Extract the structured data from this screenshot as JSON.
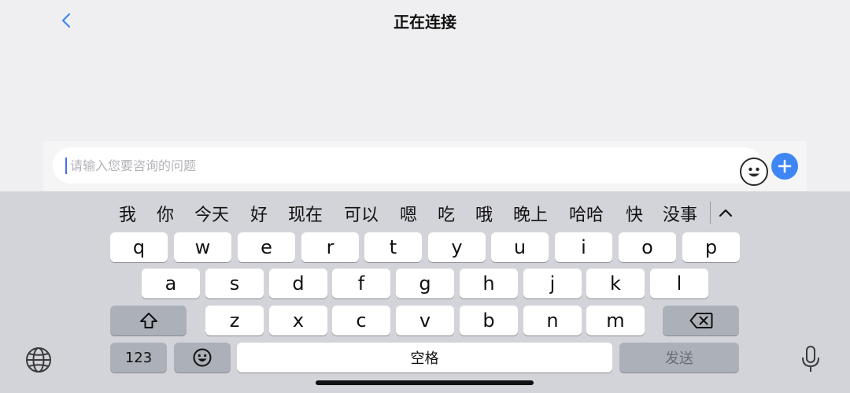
{
  "header": {
    "title": "正在连接",
    "back_icon": "chevron-left-icon"
  },
  "input": {
    "placeholder": "请输入您要咨询的问题",
    "emoji_icon": "smiley-icon",
    "plus_icon": "plus-icon"
  },
  "colors": {
    "accent": "#3f86f5",
    "caret": "#4a6cf7",
    "keyboard_bg": "#d3d4d9"
  },
  "keyboard": {
    "candidates": [
      "我",
      "你",
      "今天",
      "好",
      "现在",
      "可以",
      "嗯",
      "吃",
      "哦",
      "晚上",
      "哈哈",
      "快",
      "没事"
    ],
    "row1": [
      "q",
      "w",
      "e",
      "r",
      "t",
      "y",
      "u",
      "i",
      "o",
      "p"
    ],
    "row2": [
      "a",
      "s",
      "d",
      "f",
      "g",
      "h",
      "j",
      "k",
      "l"
    ],
    "row3": [
      "z",
      "x",
      "c",
      "v",
      "b",
      "n",
      "m"
    ],
    "numbers_label": "123",
    "space_label": "空格",
    "send_label": "发送"
  }
}
